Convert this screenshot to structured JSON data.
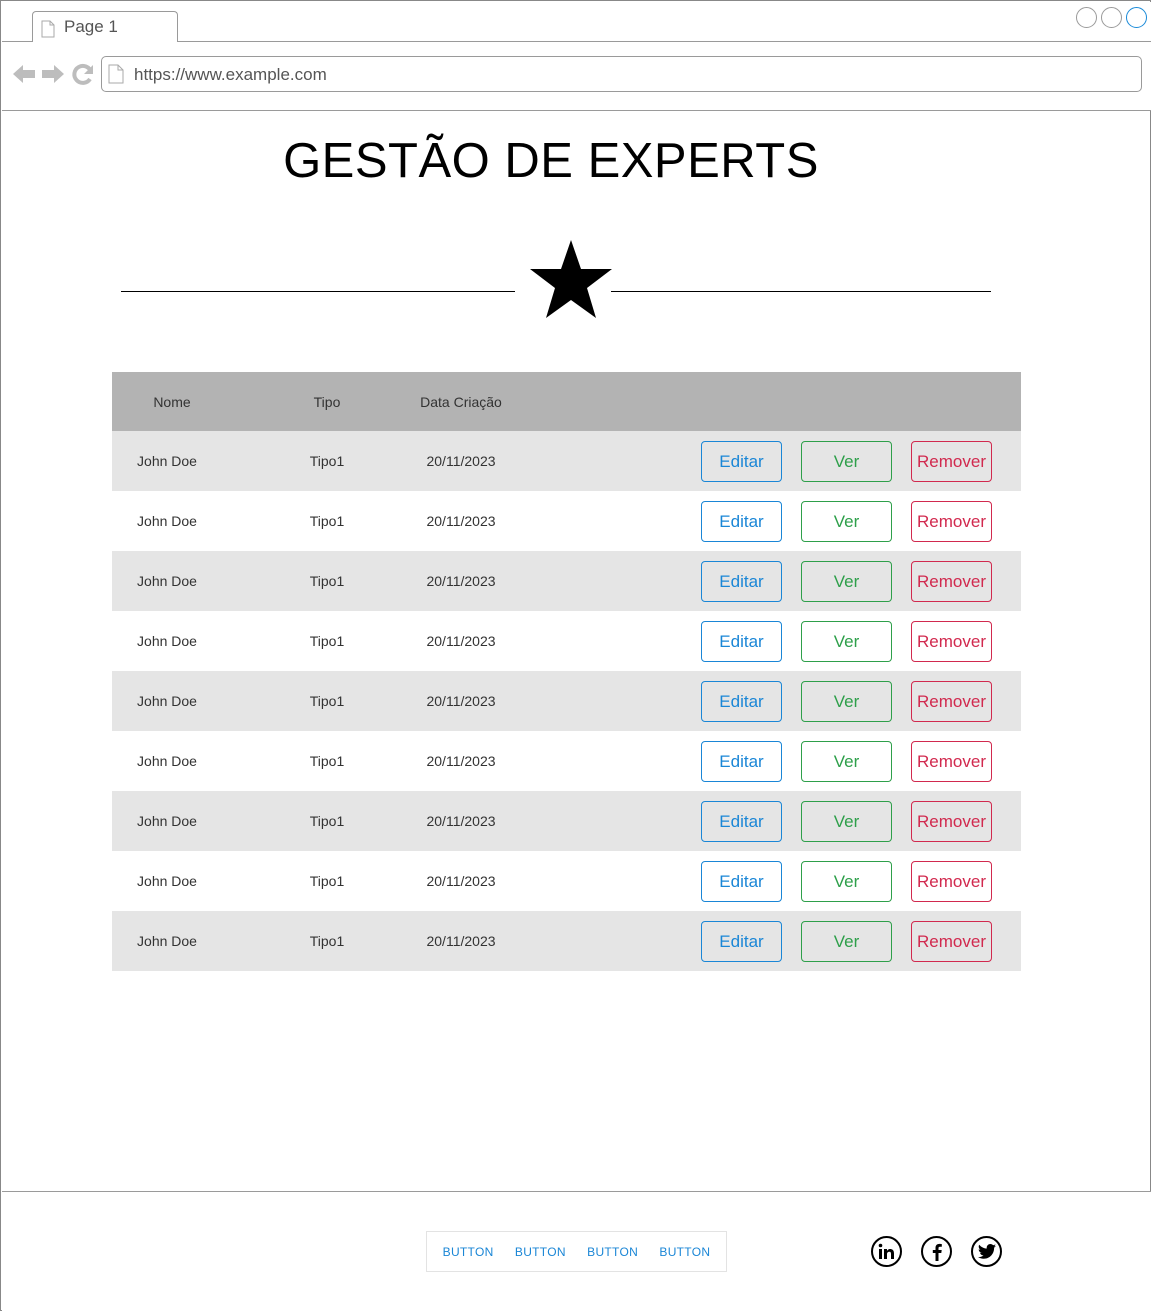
{
  "browser": {
    "tab_label": "Page 1",
    "url": "https://www.example.com"
  },
  "page": {
    "title": "GESTÃO DE EXPERTS"
  },
  "table": {
    "headers": {
      "nome": "Nome",
      "tipo": "Tipo",
      "data": "Data Criação"
    },
    "rows": [
      {
        "nome": "John Doe",
        "tipo": "Tipo1",
        "data": "20/11/2023",
        "edit": "Editar",
        "view": "Ver",
        "remove": "Remover"
      },
      {
        "nome": "John Doe",
        "tipo": "Tipo1",
        "data": "20/11/2023",
        "edit": "Editar",
        "view": "Ver",
        "remove": "Remover"
      },
      {
        "nome": "John Doe",
        "tipo": "Tipo1",
        "data": "20/11/2023",
        "edit": "Editar",
        "view": "Ver",
        "remove": "Remover"
      },
      {
        "nome": "John Doe",
        "tipo": "Tipo1",
        "data": "20/11/2023",
        "edit": "Editar",
        "view": "Ver",
        "remove": "Remover"
      },
      {
        "nome": "John Doe",
        "tipo": "Tipo1",
        "data": "20/11/2023",
        "edit": "Editar",
        "view": "Ver",
        "remove": "Remover"
      },
      {
        "nome": "John Doe",
        "tipo": "Tipo1",
        "data": "20/11/2023",
        "edit": "Editar",
        "view": "Ver",
        "remove": "Remover"
      },
      {
        "nome": "John Doe",
        "tipo": "Tipo1",
        "data": "20/11/2023",
        "edit": "Editar",
        "view": "Ver",
        "remove": "Remover"
      },
      {
        "nome": "John Doe",
        "tipo": "Tipo1",
        "data": "20/11/2023",
        "edit": "Editar",
        "view": "Ver",
        "remove": "Remover"
      },
      {
        "nome": "John Doe",
        "tipo": "Tipo1",
        "data": "20/11/2023",
        "edit": "Editar",
        "view": "Ver",
        "remove": "Remover"
      }
    ]
  },
  "footer": {
    "buttons": [
      "BUTTON",
      "BUTTON",
      "BUTTON",
      "BUTTON"
    ],
    "social_icons": [
      "linkedin-icon",
      "facebook-icon",
      "twitter-icon"
    ]
  },
  "colors": {
    "edit": "#1a86d6",
    "view": "#2e9f4a",
    "remove": "#d1294e",
    "header_bg": "#b3b3b3",
    "alt_row_bg": "#e5e5e5"
  }
}
